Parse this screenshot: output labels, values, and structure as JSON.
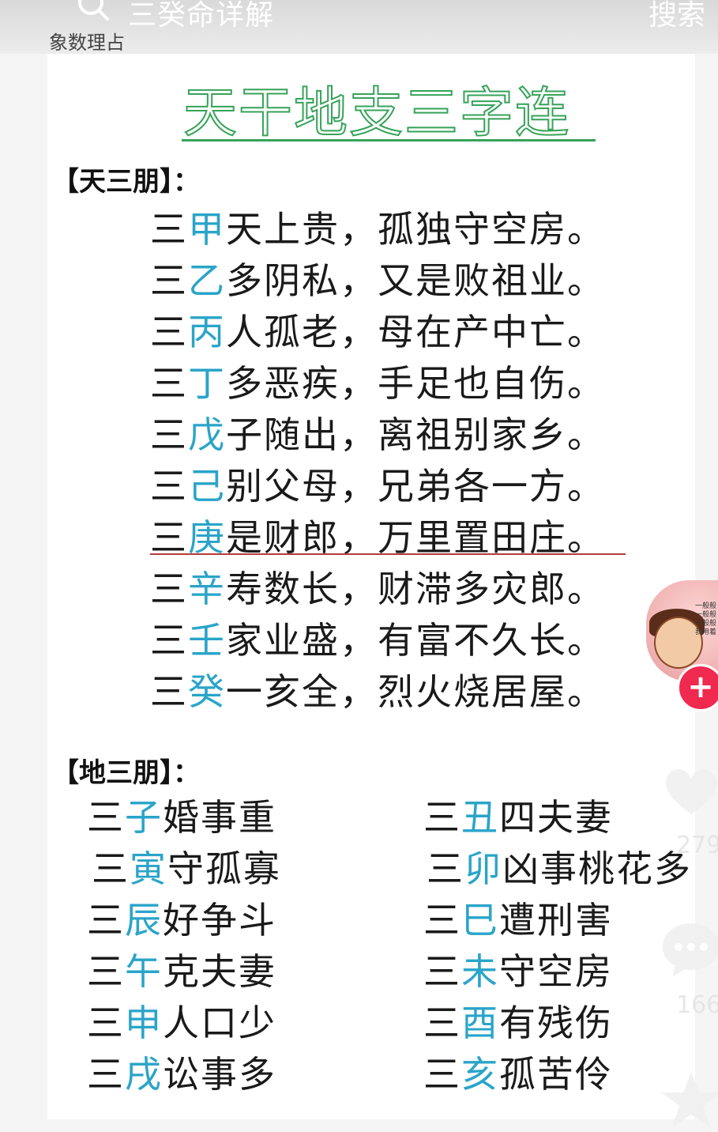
{
  "search": {
    "placeholder": "三癸命详解",
    "button_label": "搜索"
  },
  "brand": {
    "name": "象数理占"
  },
  "colors": {
    "title_green": "#36a35a",
    "stem_blue": "#2aa4c9",
    "underline_red": "#b83a3a",
    "follow_red": "#f0294f"
  },
  "article": {
    "title": "天干地支三字连",
    "heaven": {
      "heading": "【天三朋】：",
      "verses": [
        {
          "pre": "三",
          "stem": "甲",
          "rest": "天上贵，孤独守空房。"
        },
        {
          "pre": "三",
          "stem": "乙",
          "rest": "多阴私，又是败祖业。"
        },
        {
          "pre": "三",
          "stem": "丙",
          "rest": "人孤老，母在产中亡。"
        },
        {
          "pre": "三",
          "stem": "丁",
          "rest": "多恶疾，手足也自伤。"
        },
        {
          "pre": "三",
          "stem": "戊",
          "rest": "子随出，离祖别家乡。"
        },
        {
          "pre": "三",
          "stem": "己",
          "rest": "别父母，兄弟各一方。"
        },
        {
          "pre": "三",
          "stem": "庚",
          "rest": "是财郎，万里置田庄。"
        },
        {
          "pre": "三",
          "stem": "辛",
          "rest": "寿数长，财滞多灾郎。"
        },
        {
          "pre": "三",
          "stem": "壬",
          "rest": "家业盛，有富不久长。"
        },
        {
          "pre": "三",
          "stem": "癸",
          "rest": "一亥全，烈火烧居屋。"
        }
      ]
    },
    "earth": {
      "heading": "【地三朋】：",
      "left": [
        {
          "pre": "三",
          "stem": "子",
          "rest": "婚事重"
        },
        {
          "pre": "三",
          "stem": "寅",
          "rest": "守孤寡"
        },
        {
          "pre": "三",
          "stem": "辰",
          "rest": "好争斗"
        },
        {
          "pre": "三",
          "stem": "午",
          "rest": "克夫妻"
        },
        {
          "pre": "三",
          "stem": "申",
          "rest": "人口少"
        },
        {
          "pre": "三",
          "stem": "戌",
          "rest": "讼事多"
        }
      ],
      "right": [
        {
          "pre": "三",
          "stem": "丑",
          "rest": "四夫妻"
        },
        {
          "pre": "三",
          "stem": "卯",
          "rest": "凶事桃花多"
        },
        {
          "pre": "三",
          "stem": "巳",
          "rest": "遭刑害"
        },
        {
          "pre": "三",
          "stem": "未",
          "rest": "守空房"
        },
        {
          "pre": "三",
          "stem": "酉",
          "rest": "有残伤"
        },
        {
          "pre": "三",
          "stem": "亥",
          "rest": "孤苦伶"
        }
      ]
    }
  },
  "sidebar": {
    "avatar_note": [
      "一般般",
      "一般般",
      "一般般",
      "我用着"
    ],
    "follow_symbol": "+",
    "like_count": "279",
    "comment_count": "166",
    "icons": {
      "like": "heart-icon",
      "comment": "comment-icon",
      "favorite": "star-icon"
    }
  }
}
